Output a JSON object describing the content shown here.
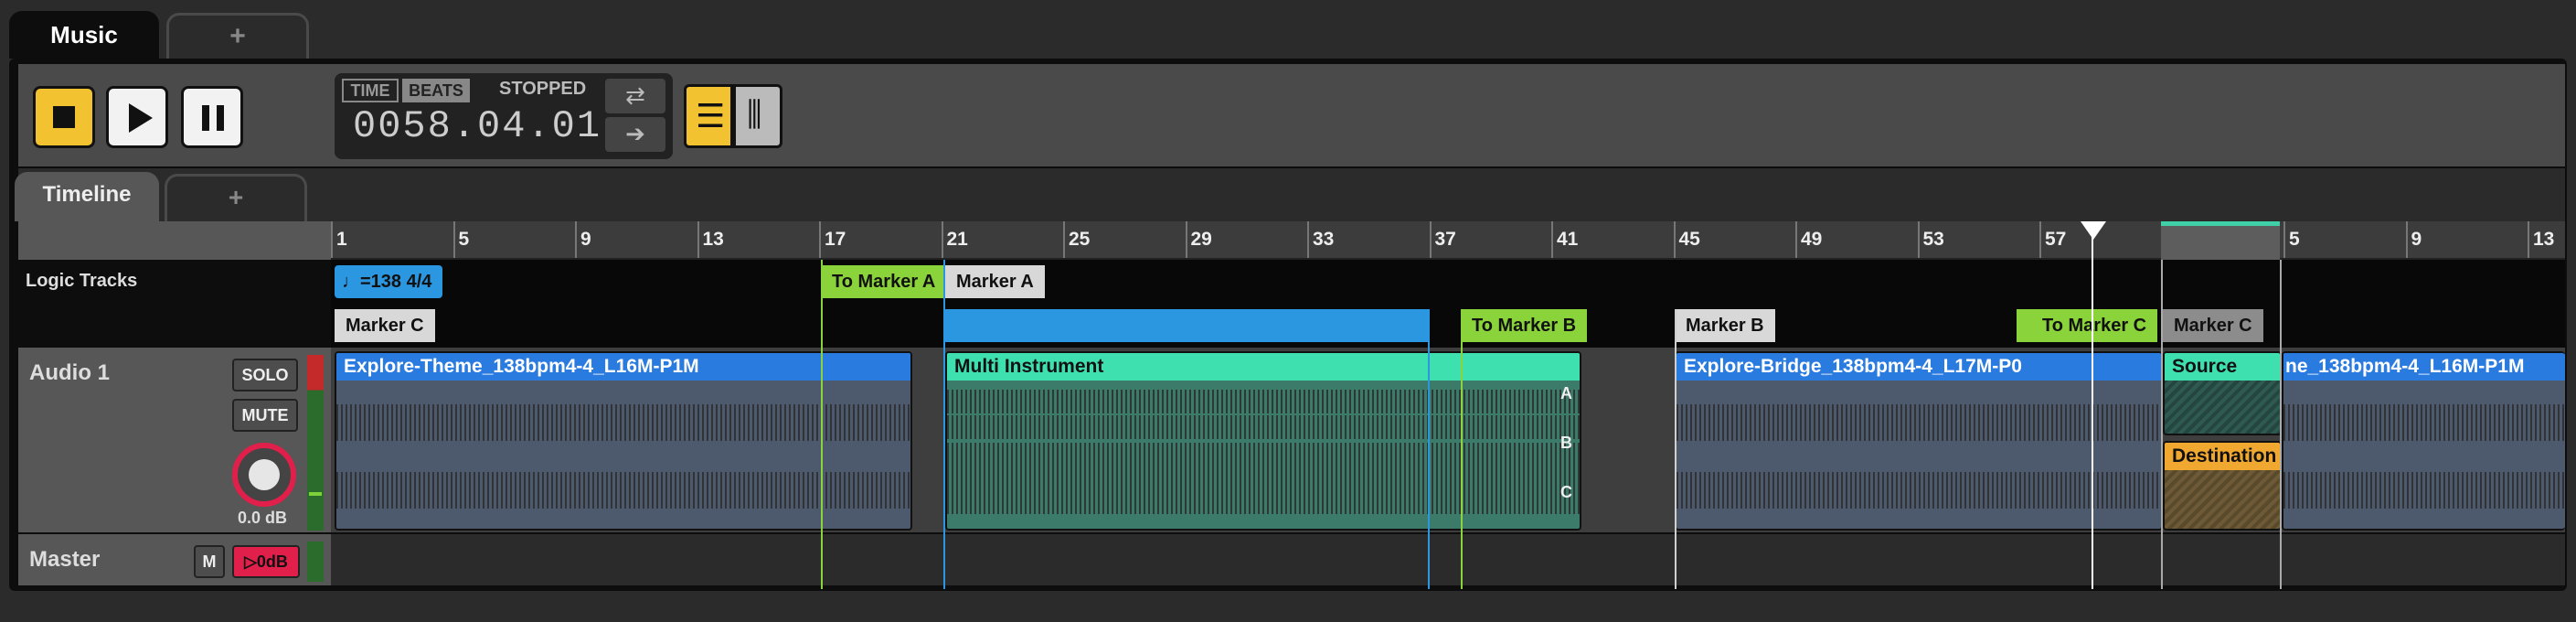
{
  "window": {
    "tab_active": "Music",
    "tab_add": "+"
  },
  "transport": {
    "time_label": "TIME",
    "beats_label": "BEATS",
    "state": "STOPPED",
    "position": "0058.04.01"
  },
  "timeline_tabs": {
    "active": "Timeline",
    "add": "+"
  },
  "ruler": {
    "numbers": [
      "1",
      "5",
      "9",
      "13",
      "17",
      "21",
      "25",
      "29",
      "33",
      "37",
      "41",
      "45",
      "49",
      "53",
      "57",
      "1",
      "5",
      "9",
      "13"
    ]
  },
  "logic": {
    "title": "Logic Tracks",
    "tempo": "=138 4/4",
    "markers": [
      "Marker C",
      "To Marker A",
      "Marker A",
      "To Marker B",
      "Marker B",
      "To Marker C",
      "Marker C"
    ]
  },
  "audio_track": {
    "name": "Audio 1",
    "solo": "SOLO",
    "mute": "MUTE",
    "volume": "0.0 dB"
  },
  "clips": {
    "c1": "Explore-Theme_138bpm4-4_L16M-P1M",
    "c2": "Multi Instrument",
    "c3": "Explore-Bridge_138bpm4-4_L17M-P0",
    "source": "Source",
    "c4": "ne_138bpm4-4_L16M-P1M",
    "destination": "Destination",
    "instr": [
      "A",
      "B",
      "C"
    ]
  },
  "master": {
    "name": "Master",
    "m": "M",
    "db": "▷0dB"
  },
  "colors": {
    "accent": "#f2c230",
    "blue": "#2a97e0",
    "green": "#8bd33b",
    "teal": "#3fe0b0",
    "orange": "#f0a830"
  }
}
